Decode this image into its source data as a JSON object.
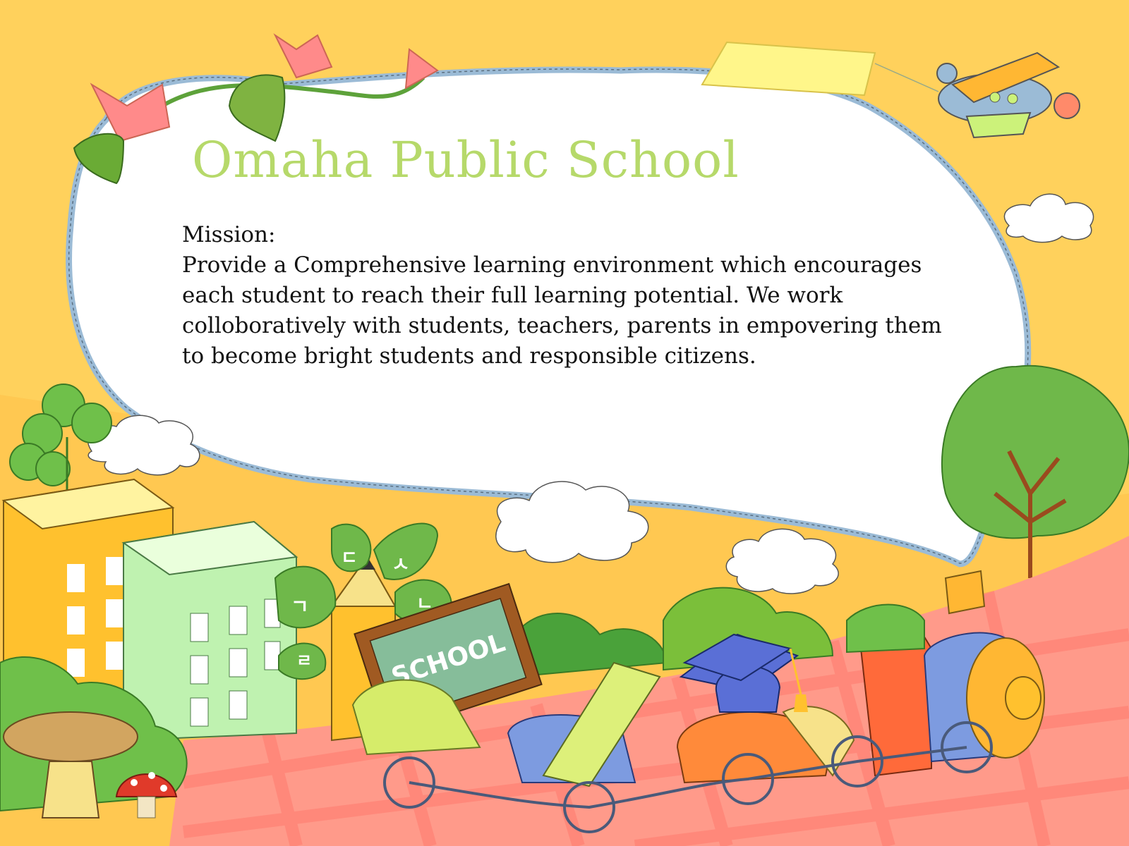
{
  "slide": {
    "title": "Omaha Public School",
    "mission_label": "Mission:",
    "mission_text": "Provide a Comprehensive learning environment which encourages each student to reach their full learning potential. We work colloboratively with students, teachers, parents in empovering them to become bright students and responsible citizens."
  },
  "illustration": {
    "chalkboard_text": "SCHOOL",
    "leaf_letters": [
      "ㄱ",
      "ㄷ",
      "ㅅ",
      "ㄴ",
      "ㄹ"
    ]
  },
  "icons": [
    "flower-vine-icon",
    "airplane-icon",
    "banner-icon",
    "cloud-icon",
    "clover-icon",
    "book-building-icon",
    "tree-icon",
    "pencil-icon",
    "chalkboard-icon",
    "train-icon",
    "mushroom-icon",
    "graduation-cap-icon"
  ],
  "colors": {
    "background": "#ffd15c",
    "title": "#b6d96a",
    "frame_border": "#9bbbd6",
    "tablecloth": "#ff9a8a"
  }
}
